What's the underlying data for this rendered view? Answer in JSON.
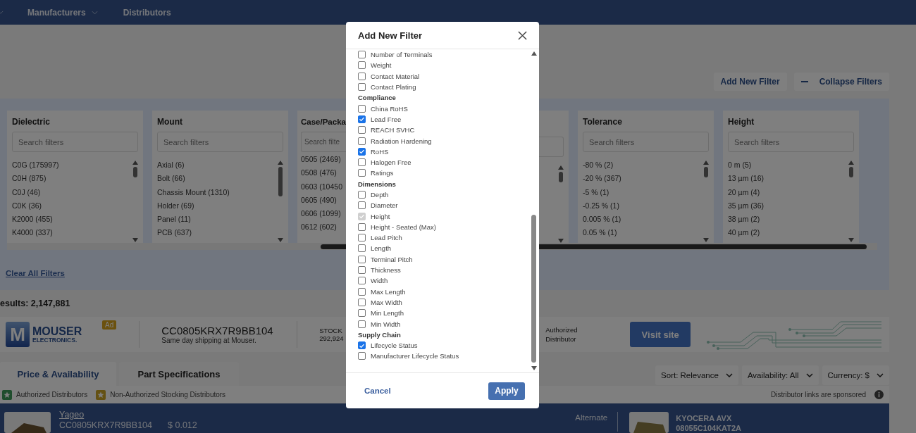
{
  "nav": [
    {
      "label": "Manufacturers",
      "dropdown": true
    },
    {
      "label": "Distributors",
      "dropdown": false
    }
  ],
  "filter_actions": [
    {
      "label": "Add New Filter",
      "kind": "add"
    },
    {
      "label": "Collapse Filters",
      "kind": "collapse"
    }
  ],
  "filter_panels": [
    {
      "title": "Dielectric",
      "placeholder": "Search filters",
      "options": [
        "C0G (175997)",
        "C0H (875)",
        "C0J (46)",
        "C0K (36)",
        "K2000 (455)",
        "K4000 (337)"
      ],
      "cut": false
    },
    {
      "title": "Mount",
      "placeholder": "Search filters",
      "options": [
        "Axial (6)",
        "Bolt (66)",
        "Chassis Mount (1310)",
        "Holder (69)",
        "Panel (11)",
        "PCB (637)"
      ],
      "cut": false
    },
    {
      "title": "Case/Packa",
      "placeholder": "Search filte",
      "options": [
        "0505 (2469)",
        "0508 (476)",
        "0603 (10450",
        "0605 (490)",
        "0606 (1099)",
        "0612 (602)"
      ],
      "cut": true
    },
    {
      "title": "Tolerance",
      "placeholder": "Search filters",
      "options": [
        "-80 % (2)",
        "-20 % (367)",
        "-5 % (1)",
        "-0.25 % (1)",
        "0.005 % (1)",
        "0.05 % (1)"
      ],
      "cut": false
    },
    {
      "title": "Height",
      "placeholder": "Search filters",
      "options": [
        "0 m (5)",
        "13 µm (16)",
        "20 µm (4)",
        "35 µm (36)",
        "38 µm (2)",
        "40 µm (2)"
      ],
      "cut": false
    }
  ],
  "clear_filters": "Clear All Filters",
  "results": "esults: 2,147,881",
  "ad": {
    "logo_mark": "M",
    "logo_name": "MOUSER",
    "logo_sub": "ELECTRONICS.",
    "badge": "Ad",
    "part": "CC0805KRX7R9BB104",
    "note": "Same day shipping at Mouser.",
    "stock_label": "STOCK",
    "stock": "292,924",
    "distributor": "Authorized Distributor",
    "button": "Visit site"
  },
  "tabs": [
    {
      "label": "Price & Availability",
      "selected": true
    },
    {
      "label": "Part Specifications",
      "selected": false
    }
  ],
  "dropdowns": [
    "Sort: Relevance",
    "Availability: All",
    "Currency: $"
  ],
  "legend": [
    {
      "label": "Authorized Distributors",
      "kind": "authorized"
    },
    {
      "label": "Non-Authorized Stocking Distributors",
      "kind": "stocking"
    }
  ],
  "sponsored": "Distributor links are sponsored",
  "result_row": {
    "manufacturer": "Yageo",
    "part": "CC0805KRX7R9BB104",
    "price": "$ 0.012",
    "alternate_label": "Alternate",
    "alt_manufacturer": "KYOCERA AVX",
    "alt_part": "08055C104KAT2A"
  },
  "dialog": {
    "title": "Add New Filter",
    "groups": [
      {
        "items": [
          {
            "label": "Number of Terminals",
            "checked": false,
            "disabled": false
          },
          {
            "label": "Weight",
            "checked": false,
            "disabled": false
          },
          {
            "label": "Contact Material",
            "checked": false,
            "disabled": false
          },
          {
            "label": "Contact Plating",
            "checked": false,
            "disabled": false
          }
        ]
      },
      {
        "heading": "Compliance",
        "items": [
          {
            "label": "China RoHS",
            "checked": false,
            "disabled": false
          },
          {
            "label": "Lead Free",
            "checked": true,
            "disabled": false
          },
          {
            "label": "REACH SVHC",
            "checked": false,
            "disabled": false
          },
          {
            "label": "Radiation Hardening",
            "checked": false,
            "disabled": false
          },
          {
            "label": "RoHS",
            "checked": true,
            "disabled": false
          },
          {
            "label": "Halogen Free",
            "checked": false,
            "disabled": false
          },
          {
            "label": "Ratings",
            "checked": false,
            "disabled": false
          }
        ]
      },
      {
        "heading": "Dimensions",
        "items": [
          {
            "label": "Depth",
            "checked": false,
            "disabled": false
          },
          {
            "label": "Diameter",
            "checked": false,
            "disabled": false
          },
          {
            "label": "Height",
            "checked": true,
            "disabled": true
          },
          {
            "label": "Height - Seated (Max)",
            "checked": false,
            "disabled": false
          },
          {
            "label": "Lead Pitch",
            "checked": false,
            "disabled": false
          },
          {
            "label": "Length",
            "checked": false,
            "disabled": false
          },
          {
            "label": "Terminal Pitch",
            "checked": false,
            "disabled": false
          },
          {
            "label": "Thickness",
            "checked": false,
            "disabled": false
          },
          {
            "label": "Width",
            "checked": false,
            "disabled": false
          },
          {
            "label": "Max Length",
            "checked": false,
            "disabled": false
          },
          {
            "label": "Max Width",
            "checked": false,
            "disabled": false
          },
          {
            "label": "Min Length",
            "checked": false,
            "disabled": false
          },
          {
            "label": "Min Width",
            "checked": false,
            "disabled": false
          }
        ]
      },
      {
        "heading": "Supply Chain",
        "items": [
          {
            "label": "Lifecycle Status",
            "checked": true,
            "disabled": false
          },
          {
            "label": "Manufacturer Lifecycle Status",
            "checked": false,
            "disabled": false
          }
        ]
      }
    ],
    "cancel": "Cancel",
    "apply": "Apply"
  }
}
